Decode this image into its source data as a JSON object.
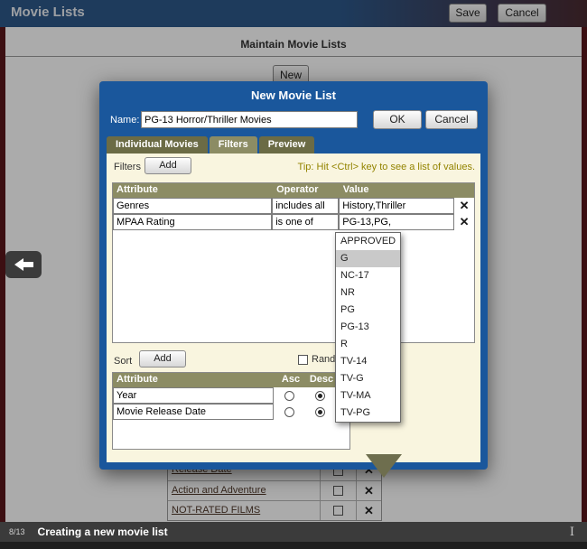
{
  "page": {
    "header": {
      "title": "Movie Lists",
      "save_label": "Save",
      "cancel_label": "Cancel"
    },
    "subheader": "Maintain Movie Lists",
    "new_button": "New",
    "background_table": {
      "rows": [
        {
          "name": "Release Date"
        },
        {
          "name": "Action and Adventure"
        },
        {
          "name": "NOT-RATED FILMS"
        }
      ]
    }
  },
  "modal": {
    "title": "New Movie List",
    "name_label": "Name:",
    "name_value": "PG-13 Horror/Thriller Movies",
    "ok_label": "OK",
    "cancel_label": "Cancel",
    "tabs": [
      {
        "label": "Individual Movies",
        "active": false
      },
      {
        "label": "Filters",
        "active": true
      },
      {
        "label": "Preview",
        "active": false
      }
    ],
    "filters": {
      "label": "Filters",
      "add_label": "Add",
      "tip": "Tip: Hit <Ctrl> key to see a list of values.",
      "columns": [
        "Attribute",
        "Operator",
        "Value"
      ],
      "rows": [
        {
          "attribute": "Genres",
          "operator": "includes all",
          "value": "History,Thriller"
        },
        {
          "attribute": "MPAA Rating",
          "operator": "is one of",
          "value": "PG-13,PG,"
        }
      ]
    },
    "dropdown": {
      "options": [
        "APPROVED",
        "G",
        "NC-17",
        "NR",
        "PG",
        "PG-13",
        "R",
        "TV-14",
        "TV-G",
        "TV-MA",
        "TV-PG"
      ],
      "highlighted": "G"
    },
    "sort": {
      "label": "Sort",
      "add_label": "Add",
      "random_label": "Rando",
      "columns": [
        "Attribute",
        "Asc",
        "Desc"
      ],
      "rows": [
        {
          "attribute": "Year",
          "asc": false,
          "desc": true
        },
        {
          "attribute": "Movie Release Date",
          "asc": false,
          "desc": true
        }
      ]
    }
  },
  "tour": {
    "step": "8/13",
    "caption": "Creating a new movie list"
  },
  "colors": {
    "modal_blue": "#1a579c",
    "olive_header": "#8c8c64",
    "cream": "#f9f5df",
    "tip_text": "#938400",
    "page_edge_maroon": "#5a171b",
    "status_bar": "#3b3b3b"
  }
}
